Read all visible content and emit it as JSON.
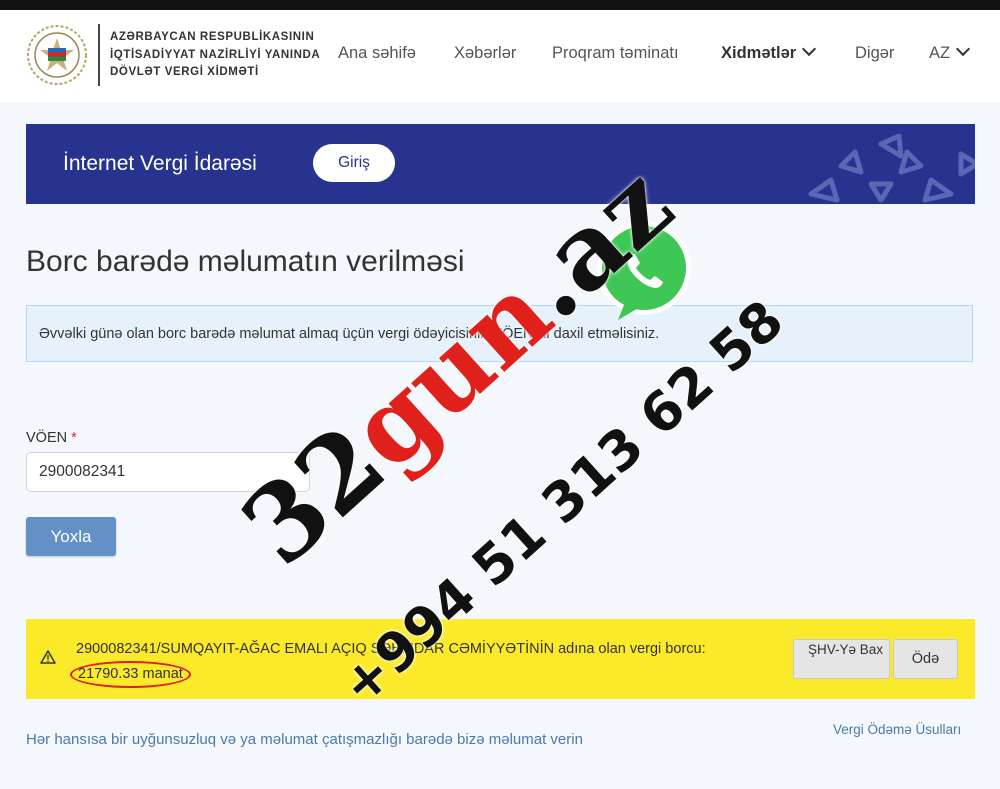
{
  "header": {
    "org_name_lines": [
      "AZƏRBAYCAN RESPUBLİKASININ",
      "İQTİSADİYYAT NAZİRLİYİ YANINDA",
      "DÖVLƏT VERGİ XİDMƏTİ"
    ],
    "nav": {
      "home": "Ana səhifə",
      "news": "Xəbərlər",
      "software": "Proqram təminatı",
      "services": "Xidmətlər",
      "other": "Digər",
      "lang": "AZ"
    }
  },
  "banner": {
    "title": "İnternet Vergi İdarəsi",
    "login_label": "Giriş"
  },
  "page": {
    "title": "Borc barədə məlumatın verilməsi",
    "info_text": "Əvvəlki günə olan borc barədə məlumat almaq üçün vergi ödəyicisinin VÖEN-ni daxil etməlisiniz."
  },
  "form": {
    "voen_label": "VÖEN",
    "required_mark": "*",
    "voen_value": "2900082341",
    "check_button": "Yoxla"
  },
  "result": {
    "text": "2900082341/SUMQAYIT-AĞAC EMALI AÇIQ SƏHMDAR CƏMİYYƏTİNİN adına olan vergi borcu:",
    "amount": "21790.33 manat",
    "shv_button": "ŞHV-Yə Bax",
    "pay_button": "Ödə"
  },
  "footer": {
    "feedback_link": "Hər hansısa bir uyğunsuzluq və ya məlumat çatışmazlığı barədə bizə məlumat verin",
    "payment_methods_link": "Vergi Ödəmə Üsulları"
  },
  "watermark": {
    "domain_number": "32",
    "domain_word": "gun",
    "domain_tld": ".az",
    "phone": "+994 51 313 62 58"
  },
  "colors": {
    "banner_bg": "#27338f",
    "result_bg": "#fbea2a",
    "check_button_bg": "#6490c8",
    "link": "#4d7aa8",
    "highlight_circle": "#e02020",
    "whatsapp_green": "#3ec754"
  },
  "icons": [
    "emblem-icon",
    "chevron-down-icon",
    "warning-icon",
    "whatsapp-icon"
  ]
}
